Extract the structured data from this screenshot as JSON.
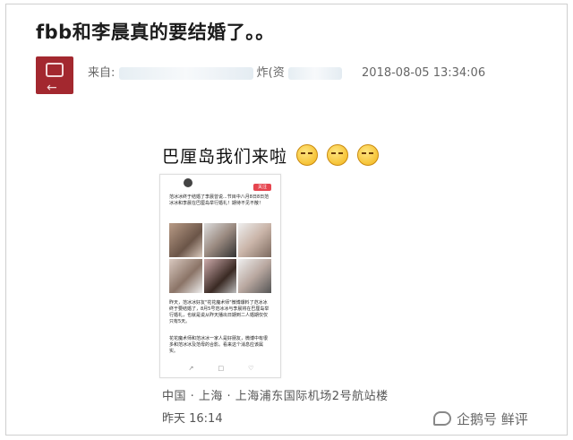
{
  "post": {
    "title": "fbb和李晨真的要结婚了。。",
    "source_label": "来自:",
    "source_partial_1": "炸(资",
    "timestamp": "2018-08-05 13:34:06"
  },
  "image": {
    "caption": "巴厘岛我们来啦",
    "emoji_icons": [
      "smirk-emoji",
      "smirk-emoji",
      "smirk-emoji"
    ],
    "screenshot": {
      "follow_label": "关注",
      "intro_text": "范冰冰终于结婚了李晨曾说...节目中八月8日8日范冰冰和李晨在巴厘岛举行婚礼！期待不见不散！",
      "body_text": "昨天，范冰冰好友\"花花魔术师\"微博爆料了范冰冰终于要结婚了，8月5号范冰冰与李晨将在巴厘岛举行婚礼，也就是说从昨天播出日期到二人婚期仅仅只有5天。",
      "body_text_2": "花花魔术师和范冰冰一家人是好朋友，微博中有很多和范冰冰及范母的合影。看来这个消息应该属实。"
    },
    "location": "中国 · 上海 · 上海浦东国际机场2号航站楼",
    "post_time": "昨天 16:14"
  },
  "watermark": {
    "text": "企鹅号 鲜评"
  },
  "colors": {
    "avatar_bg": "#a3282f",
    "follow_button": "#e6454f"
  }
}
